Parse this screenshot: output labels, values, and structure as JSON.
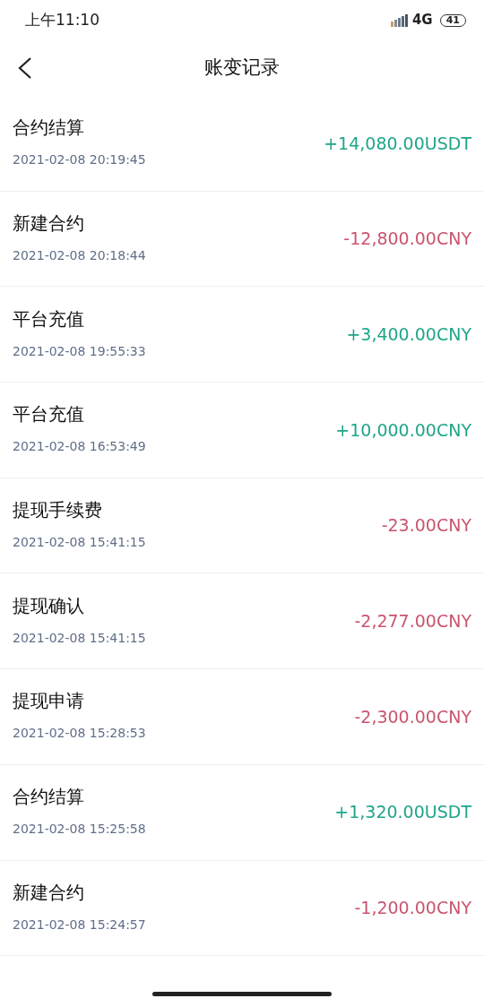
{
  "status_bar": {
    "time": "上午11:10",
    "network": "4G",
    "battery": "41"
  },
  "nav": {
    "title": "账变记录"
  },
  "records": [
    {
      "title": "合约结算",
      "time": "2021-02-08 20:19:45",
      "amount": "+14,080.00USDT",
      "color": "#1fa58a"
    },
    {
      "title": "新建合约",
      "time": "2021-02-08 20:18:44",
      "amount": "-12,800.00CNY",
      "color": "#c9546d"
    },
    {
      "title": "平台充值",
      "time": "2021-02-08 19:55:33",
      "amount": "+3,400.00CNY",
      "color": "#1fa58a"
    },
    {
      "title": "平台充值",
      "time": "2021-02-08 16:53:49",
      "amount": "+10,000.00CNY",
      "color": "#1fa58a"
    },
    {
      "title": "提现手续费",
      "time": "2021-02-08 15:41:15",
      "amount": "-23.00CNY",
      "color": "#c9546d"
    },
    {
      "title": "提现确认",
      "time": "2021-02-08 15:41:15",
      "amount": "-2,277.00CNY",
      "color": "#c9546d"
    },
    {
      "title": "提现申请",
      "time": "2021-02-08 15:28:53",
      "amount": "-2,300.00CNY",
      "color": "#c9546d"
    },
    {
      "title": "合约结算",
      "time": "2021-02-08 15:25:58",
      "amount": "+1,320.00USDT",
      "color": "#1fa58a"
    },
    {
      "title": "新建合约",
      "time": "2021-02-08 15:24:57",
      "amount": "-1,200.00CNY",
      "color": "#c9546d"
    }
  ]
}
